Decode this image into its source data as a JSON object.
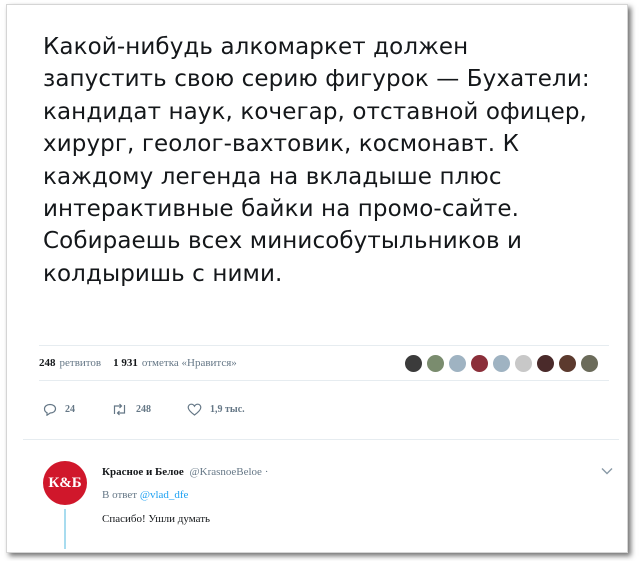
{
  "tweet": {
    "lines": [
      "Какой-нибудь алкомаркет должен",
      "запустить свою серию фигурок — Бухатели:",
      "кандидат наук, кочегар, отставной офицер,",
      "хирург, геолог-вахтовик, космонавт. К",
      "каждому легенда на вкладыше плюс",
      "интерактивные байки на промо-сайте.",
      "Собираешь всех минисобутыльников и",
      "колдыришь с ними."
    ]
  },
  "stats": {
    "retweets_count": "248",
    "retweets_label": "ретвитов",
    "likes_count": "1 931",
    "likes_label": "отметка «Нравится»",
    "avatar_colors": [
      "#3b3b3b",
      "#7a8c6e",
      "#9fb3c2",
      "#8b2f3a",
      "#9fb3c2",
      "#c8c8c8",
      "#4a2a2a",
      "#5c3a2e",
      "#6b6b5a"
    ]
  },
  "actions": {
    "replies": "24",
    "retweets": "248",
    "likes": "1,9 тыс."
  },
  "reply": {
    "avatar_text": "К&Б",
    "avatar_color": "#d0172b",
    "name": "Красное и Белое",
    "handle": "@KrasnoeBeloe",
    "dot": "·",
    "in_reply_prefix": "В ответ",
    "in_reply_handle": "@vlad_dfe",
    "text": "Спасибо! Ушли думать"
  }
}
